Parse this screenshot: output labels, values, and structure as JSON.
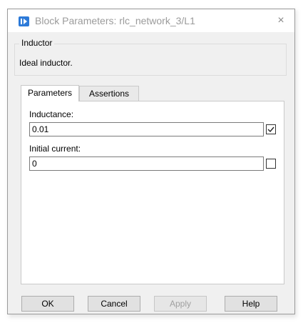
{
  "window": {
    "title": "Block Parameters: rlc_network_3/L1",
    "close_glyph": "×"
  },
  "group": {
    "legend": "Inductor",
    "description": "Ideal inductor."
  },
  "tabs": [
    {
      "label": "Parameters",
      "active": true
    },
    {
      "label": "Assertions",
      "active": false
    }
  ],
  "parameters": {
    "inductance": {
      "label": "Inductance:",
      "value": "0.01",
      "checked": true
    },
    "initial_current": {
      "label": "Initial current:",
      "value": "0",
      "checked": false
    }
  },
  "buttons": {
    "ok": "OK",
    "cancel": "Cancel",
    "apply": "Apply",
    "help": "Help"
  },
  "icons": {
    "app": "block-parameters-icon",
    "close": "close-icon",
    "check": "checkmark-icon"
  },
  "colors": {
    "accent": "#2d7ad8",
    "title_text": "#9b9b9b",
    "disabled_text": "#a0a0a0"
  }
}
